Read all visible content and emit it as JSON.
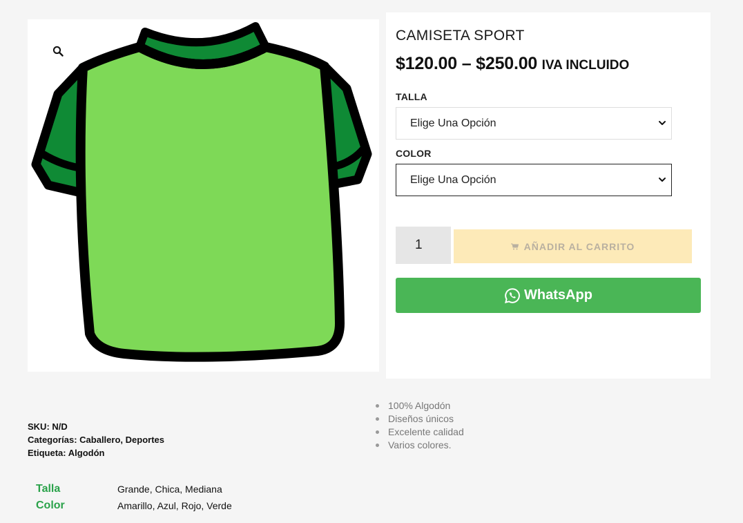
{
  "product": {
    "title": "CAMISETA SPORT",
    "price_range": "$120.00 – $250.00",
    "price_suffix": "IVA INCLUIDO"
  },
  "icons": {
    "zoom": "magnifier-icon",
    "select_arrow": "chevron-down-icon",
    "cart": "cart-icon",
    "whatsapp": "whatsapp-icon"
  },
  "variations": {
    "talla": {
      "label": "TALLA",
      "selected": "Elige Una Opción"
    },
    "color": {
      "label": "COLOR",
      "selected": "Elige Una Opción"
    }
  },
  "cart": {
    "quantity": "1",
    "add_button": "AÑADIR AL CARRITO"
  },
  "whatsapp": {
    "label": "WhatsApp"
  },
  "features": [
    "100% Algodón",
    "Diseños únicos",
    "Excelente calidad",
    "Varios colores."
  ],
  "meta": {
    "sku_label": "SKU:",
    "sku_value": "N/D",
    "categories_label": "Categorías:",
    "categories": [
      "Caballero",
      "Deportes"
    ],
    "tag_label": "Etiqueta:",
    "tag": "Algodón"
  },
  "attributes": [
    {
      "name": "Talla",
      "value": "Grande, Chica, Mediana"
    },
    {
      "name": "Color",
      "value": "Amarillo, Azul, Rojo, Verde"
    }
  ],
  "colors": {
    "accent_green": "#2aa24a",
    "whatsapp_green": "#4ab656",
    "add_to_cart_disabled": "#fdeab8",
    "shirt_body": "#7ed957",
    "shirt_trim": "#0f8a35"
  }
}
